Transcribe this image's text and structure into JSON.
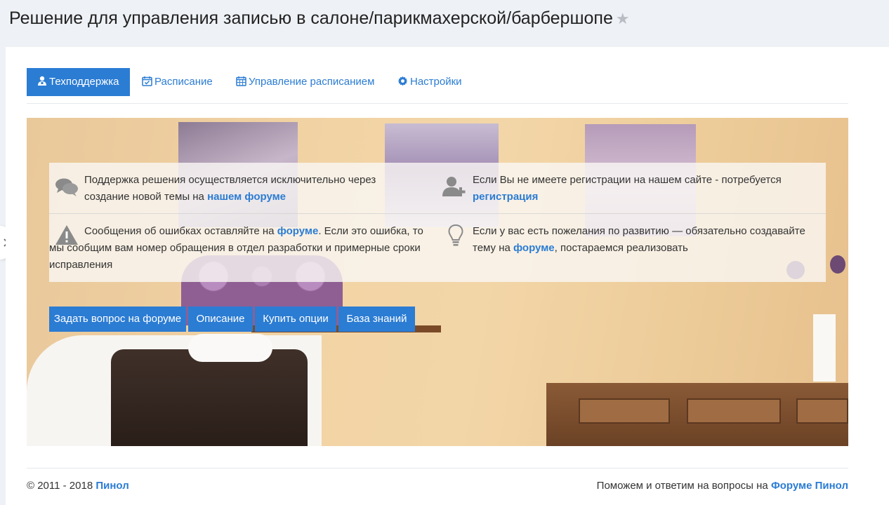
{
  "page": {
    "title": "Решение для управления записью в салоне/парикмахерской/барбершопе",
    "favorite_icon": "star-icon"
  },
  "tabs": [
    {
      "label": "Техподдержка",
      "icon": "support-user-icon",
      "active": true
    },
    {
      "label": "Расписание",
      "icon": "calendar-check-icon",
      "active": false
    },
    {
      "label": "Управление расписанием",
      "icon": "calendar-grid-icon",
      "active": false
    },
    {
      "label": "Настройки",
      "icon": "gear-icon",
      "active": false
    }
  ],
  "info": {
    "forum_support": {
      "icon": "comments-icon",
      "text_before": "Поддержка решения осуществляется исключительно через создание новой темы на ",
      "link": "нашем форуме"
    },
    "registration": {
      "icon": "user-plus-icon",
      "text_before": "Если Вы не имеете регистрации на нашем сайте - потребуется ",
      "link": "регистрация"
    },
    "bug_reports": {
      "icon": "warning-icon",
      "text_before": "Сообщения об ошибках оставляйте на ",
      "link": "форуме",
      "text_after": ". Если это ошибка, то мы сообщим вам номер обращения в отдел разработки и примерные сроки исправления"
    },
    "suggestions": {
      "icon": "lightbulb-icon",
      "text_before": "Если у вас есть пожелания по развитию — обязательно создавайте тему на ",
      "link": "форуме",
      "text_after": ", постараемся реализовать"
    }
  },
  "buttons": {
    "ask_forum": "Задать вопрос на форуме",
    "description": "Описание",
    "buy_options": "Купить опции",
    "knowledge_base": "База знаний"
  },
  "footer": {
    "copyright": "© 2011 - 2018",
    "brand_link": "Пинол",
    "help_text": "Поможем и ответим на вопросы на",
    "forum_link": "Форуме Пинол"
  },
  "colors": {
    "accent": "#2b7cd3",
    "header_bg": "#eef1f5"
  }
}
